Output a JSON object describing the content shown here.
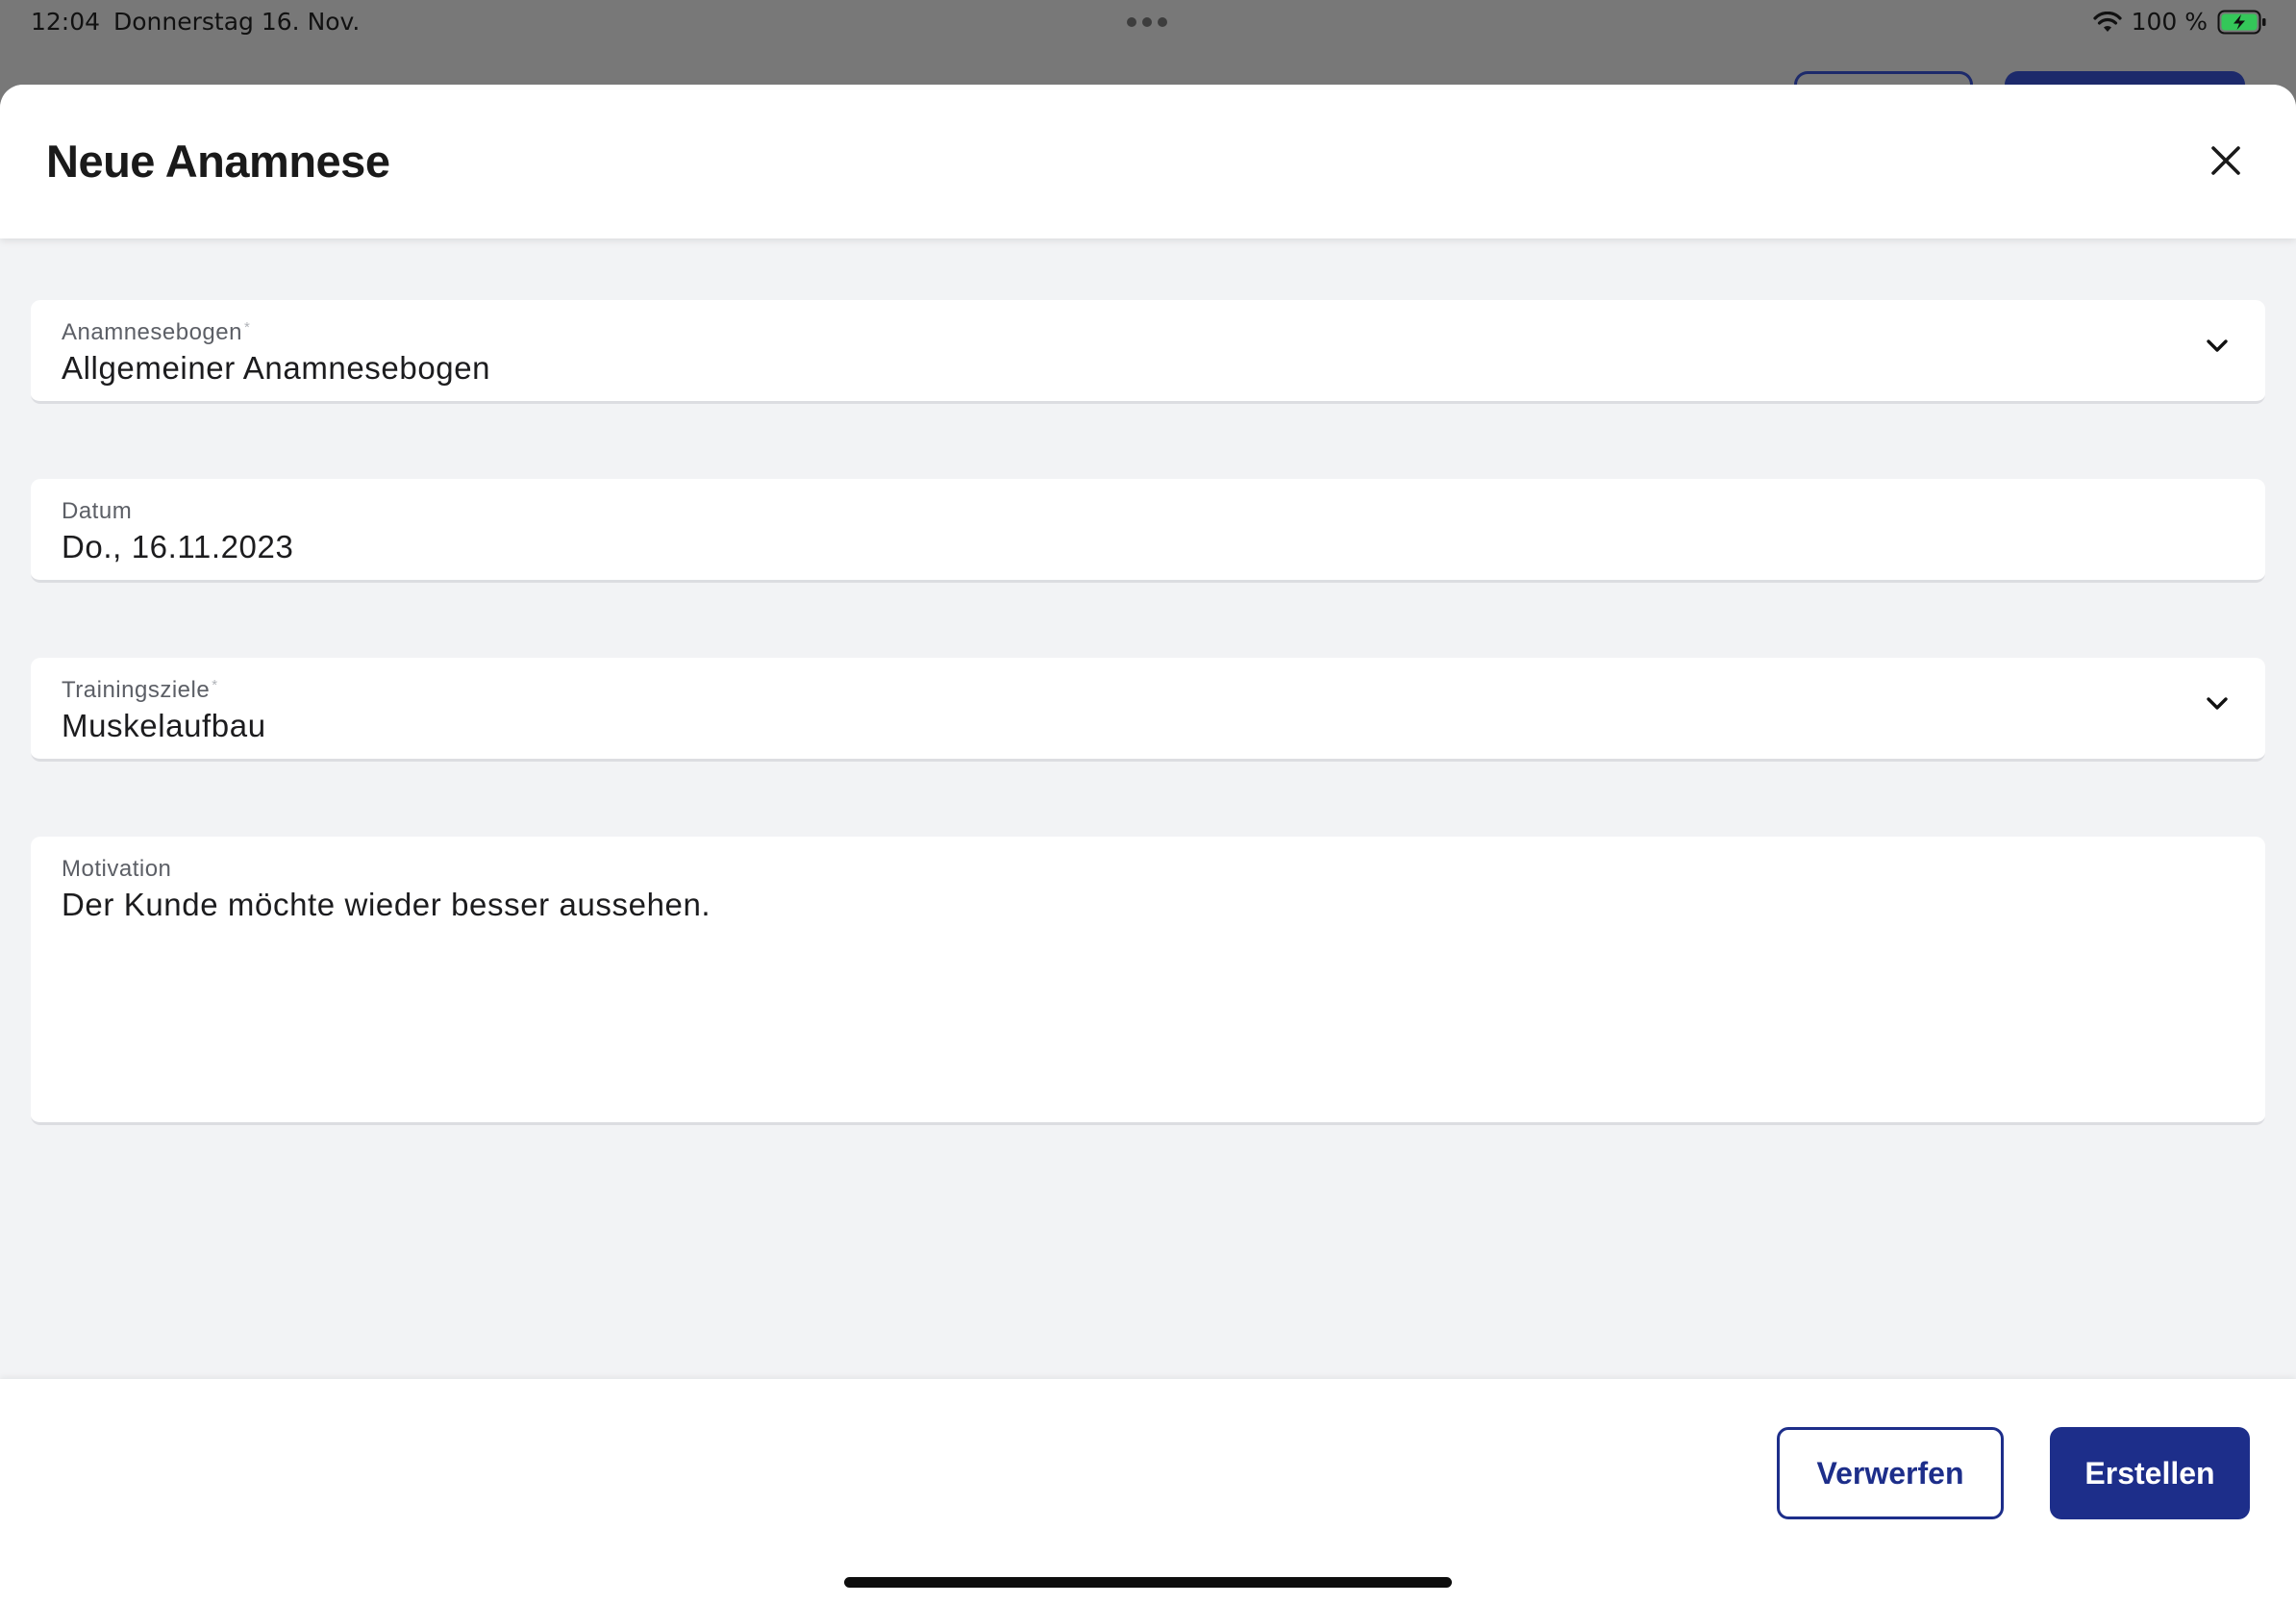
{
  "status_bar": {
    "time": "12:04",
    "date": "Donnerstag 16. Nov.",
    "battery_percent": "100 %",
    "wifi_icon": "wifi-icon",
    "battery_icon": "battery-charging-icon",
    "battery_color": "#34c759"
  },
  "sheet": {
    "title": "Neue Anamnese",
    "close_icon": "close-icon"
  },
  "form": {
    "anamnesebogen": {
      "label": "Anamnesebogen",
      "required_mark": "*",
      "value": "Allgemeiner Anamnesebogen",
      "icon": "chevron-down-icon"
    },
    "datum": {
      "label": "Datum",
      "value": "Do., 16.11.2023"
    },
    "trainingsziele": {
      "label": "Trainingsziele",
      "required_mark": "*",
      "value": "Muskelaufbau",
      "icon": "chevron-down-icon"
    },
    "motivation": {
      "label": "Motivation",
      "value": "Der Kunde möchte wieder besser aussehen."
    }
  },
  "footer": {
    "discard_label": "Verwerfen",
    "create_label": "Erstellen"
  },
  "colors": {
    "primary": "#1d2e8a",
    "sheet_background": "#f2f3f5",
    "field_background": "#ffffff",
    "dimmed_overlay": "#787878"
  }
}
